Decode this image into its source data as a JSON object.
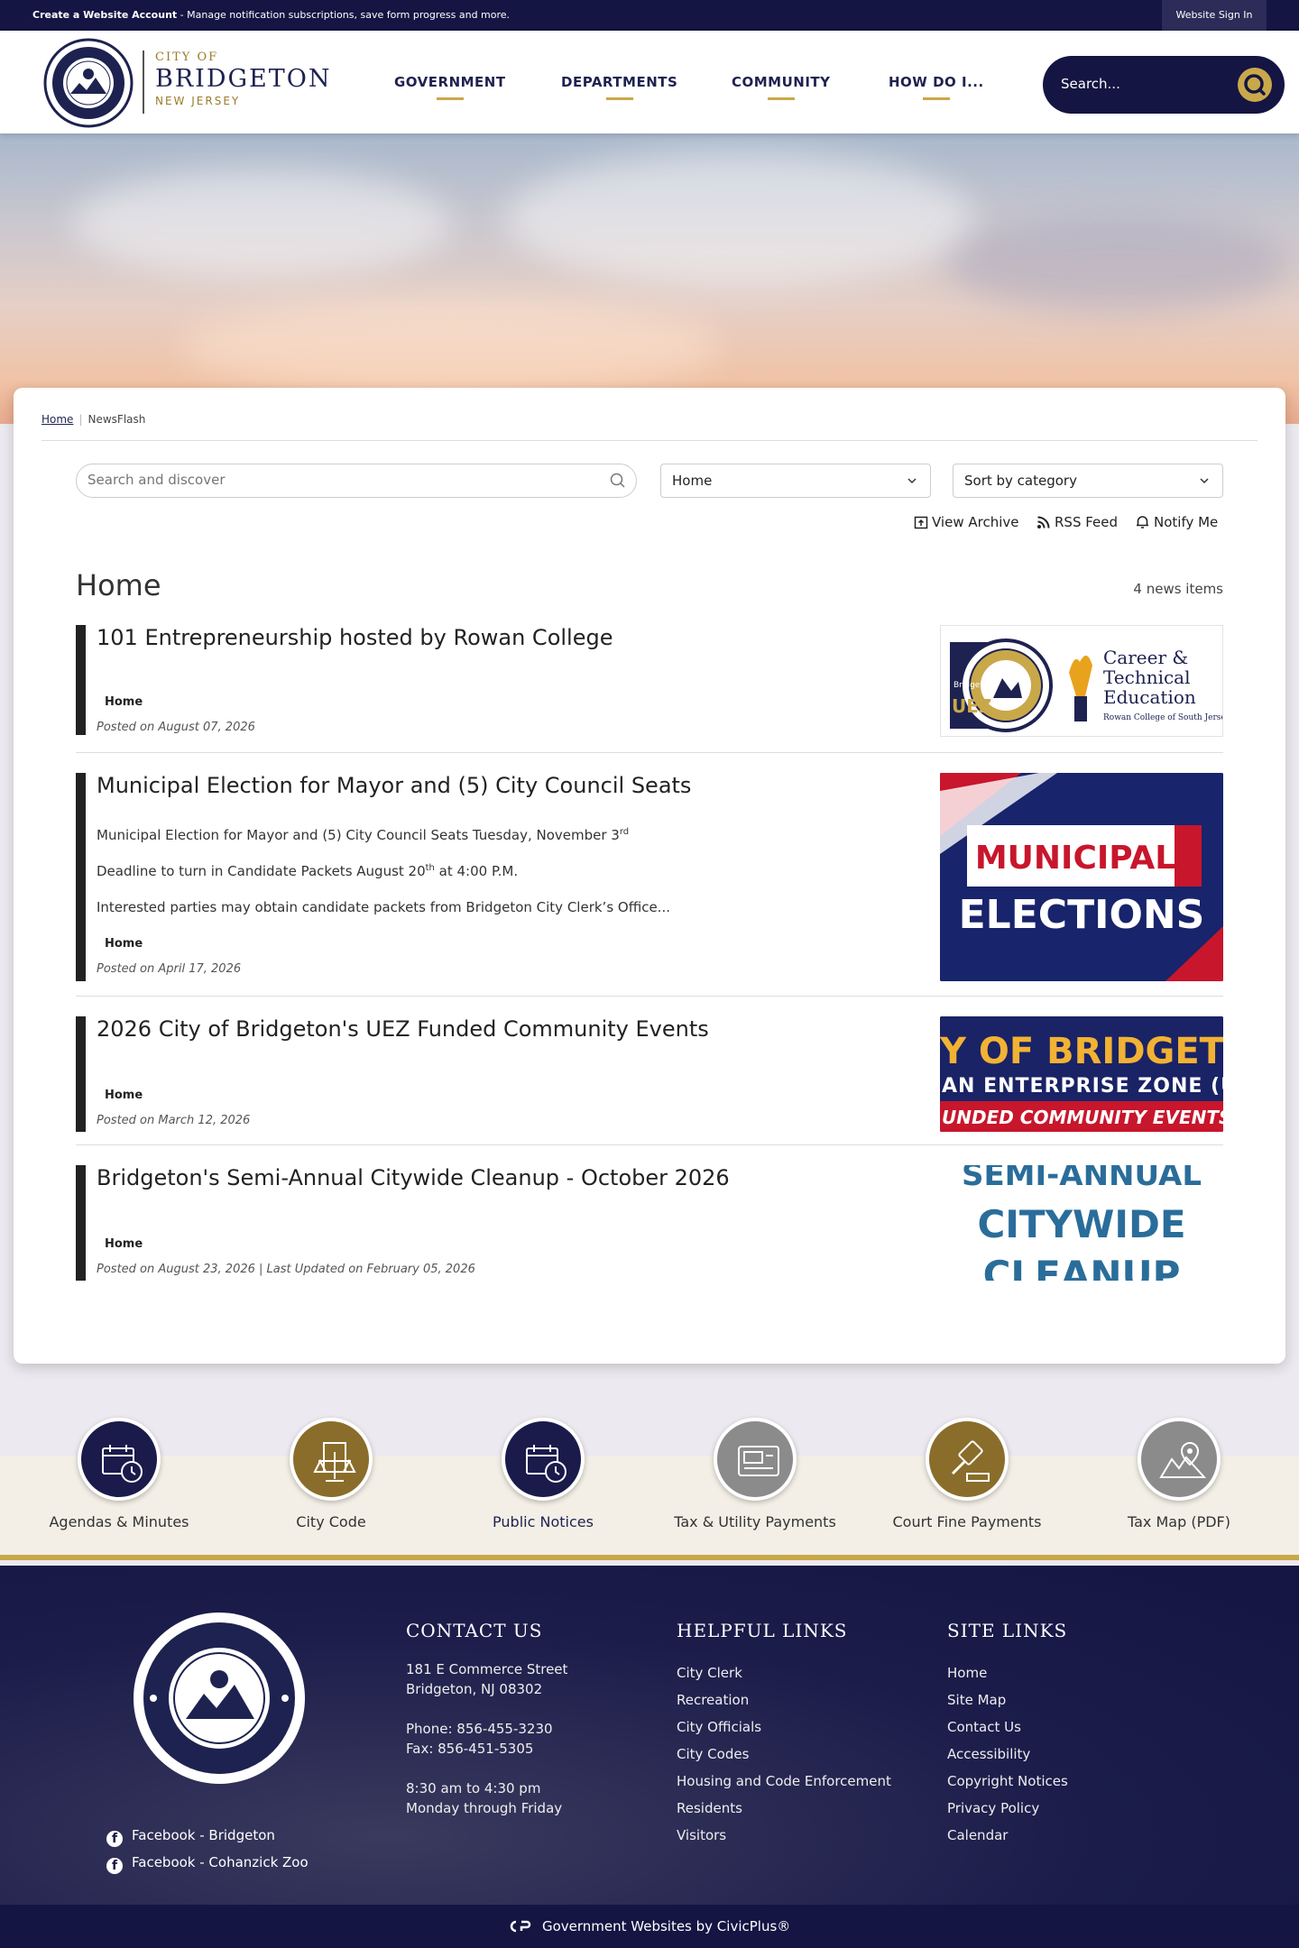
{
  "topbar": {
    "create_account_bold": "Create a Website Account",
    "create_account_rest": " - Manage notification subscriptions, save form progress and more.",
    "sign_in": "Website Sign In"
  },
  "logo": {
    "line1": "CITY OF",
    "line2": "BRIDGETON",
    "line3": "NEW JERSEY"
  },
  "nav": {
    "items": [
      "GOVERNMENT",
      "DEPARTMENTS",
      "COMMUNITY",
      "HOW DO I..."
    ]
  },
  "search": {
    "placeholder": "Search..."
  },
  "breadcrumb": {
    "home": "Home",
    "current": "NewsFlash"
  },
  "filters": {
    "search_placeholder": "Search and discover",
    "category": "Home",
    "sort": "Sort by category"
  },
  "tools": {
    "archive": "View Archive",
    "rss": "RSS Feed",
    "notify": "Notify Me"
  },
  "section": {
    "title": "Home",
    "count": "4 news items"
  },
  "news": [
    {
      "title": "101 Entrepreneurship hosted by Rowan College",
      "category": "Home",
      "posted": "Posted on August 07, 2026",
      "thumb": {
        "uez": "UEZ",
        "uez_top": "Bridgeton",
        "cte1": "Career &",
        "cte2": "Technical",
        "cte3": "Education",
        "cte4": "Rowan College of South Jersey"
      }
    },
    {
      "title": "Municipal Election for Mayor and (5) City Council Seats",
      "body1": "Municipal Election for Mayor and (5) City Council Seats Tuesday, November 3",
      "body1_sup": "rd",
      "body2a": "Deadline to turn in Candidate Packets August 20",
      "body2_sup": "th",
      "body2b": " at 4:00 P.M.",
      "body3": "Interested parties may obtain candidate packets from Bridgeton City Clerk’s Office...",
      "category": "Home",
      "posted": "Posted on April 17, 2026",
      "thumb": {
        "line1": "MUNICIPAL",
        "line2": "ELECTIONS"
      }
    },
    {
      "title": "2026 City of Bridgeton's UEZ Funded Community Events",
      "category": "Home",
      "posted": "Posted on March 12, 2026",
      "thumb": {
        "line1": "Y OF BRIDGETO",
        "line2": "AN ENTERPRISE ZONE (U",
        "line3": "UNDED COMMUNITY EVENTS"
      }
    },
    {
      "title": "Bridgeton's Semi-Annual Citywide Cleanup - October 2026",
      "category": "Home",
      "posted": "Posted on August 23, 2026 | Last Updated on February 05, 2026",
      "thumb": {
        "line1": "SEMI-ANNUAL",
        "line2": "CITYWIDE",
        "line3": "CLEANUP"
      }
    }
  ],
  "quick_links": [
    {
      "label": "Agendas & Minutes",
      "icon": "calendar-clock-icon",
      "color": "#1a1b4b"
    },
    {
      "label": "City Code",
      "icon": "scales-document-icon",
      "color": "#8a6d2a"
    },
    {
      "label": "Public Notices",
      "icon": "calendar-clock-icon",
      "color": "#1a1b4b"
    },
    {
      "label": "Tax & Utility Payments",
      "icon": "payment-card-icon",
      "color": "#8b8b8b"
    },
    {
      "label": "Court Fine Payments",
      "icon": "gavel-icon",
      "color": "#8a6d2a"
    },
    {
      "label": "Tax Map (PDF)",
      "icon": "map-pin-icon",
      "color": "#8b8b8b"
    }
  ],
  "footer": {
    "social": [
      "Facebook - Bridgeton",
      "Facebook - Cohanzick Zoo"
    ],
    "contact": {
      "heading": "CONTACT US",
      "address1": "181 E Commerce Street",
      "address2": "Bridgeton, NJ 08302",
      "phone": "Phone: 856-455-3230",
      "fax": "Fax: 856-451-5305",
      "hours1": "8:30 am to 4:30 pm",
      "hours2": "Monday through Friday"
    },
    "helpful": {
      "heading": "HELPFUL LINKS",
      "links": [
        "City Clerk",
        "Recreation",
        "City Officials",
        "City Codes",
        "Housing and Code Enforcement",
        "Residents",
        "Visitors"
      ]
    },
    "site": {
      "heading": "SITE LINKS",
      "links": [
        "Home",
        "Site Map",
        "Contact Us",
        "Accessibility",
        "Copyright Notices",
        "Privacy Policy",
        "Calendar"
      ]
    },
    "credit": "Government Websites by CivicPlus®"
  }
}
